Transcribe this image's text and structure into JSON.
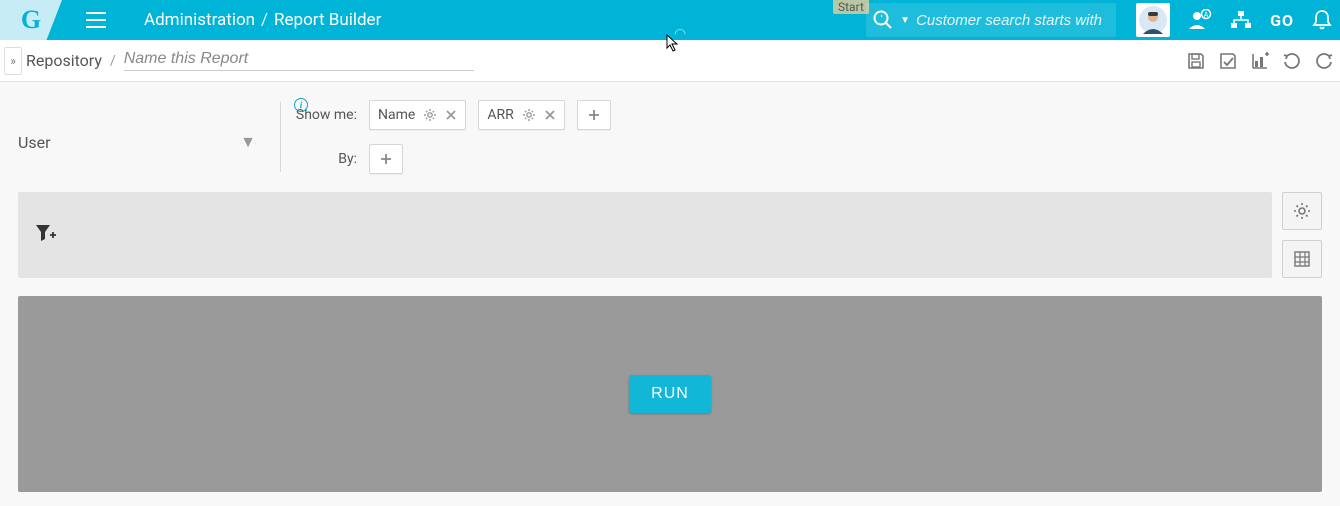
{
  "header": {
    "logo_letter": "G",
    "breadcrumb_section": "Administration",
    "breadcrumb_page": "Report Builder",
    "start_tag": "Start",
    "search_placeholder": "Customer search starts with",
    "go_label": "GO"
  },
  "subheader": {
    "repository_label": "Repository",
    "name_placeholder": "Name this Report"
  },
  "builder": {
    "source_label": "User",
    "show_me_label": "Show me:",
    "by_label": "By:",
    "fields": [
      {
        "label": "Name"
      },
      {
        "label": "ARR"
      }
    ],
    "run_label": "RUN"
  }
}
